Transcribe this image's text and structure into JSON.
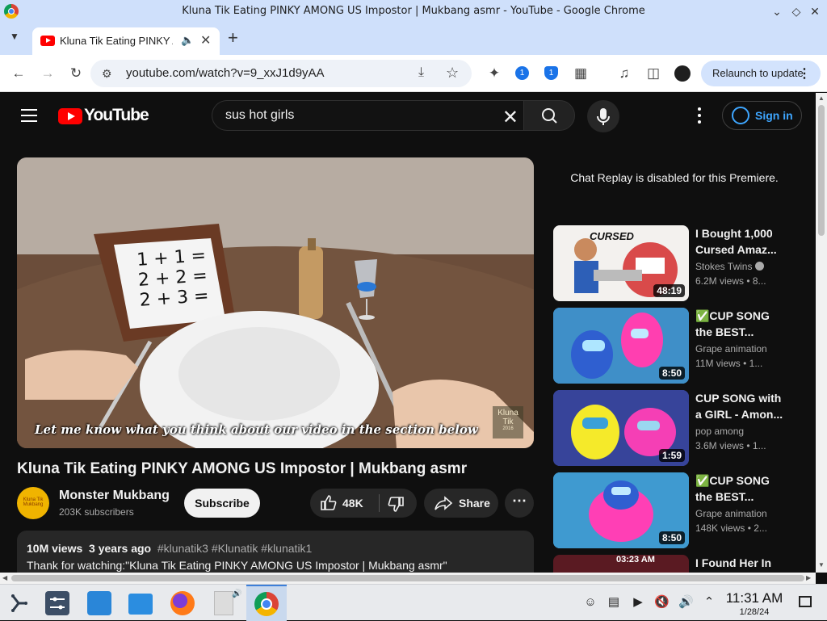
{
  "window": {
    "title": "Kluna Tik Eating PINKY AMONG US Impostor | Mukbang asmr - YouTube - Google Chrome"
  },
  "tab": {
    "label": "Kluna Tik Eating PINKY AMONG US Impostor | Mukbang asmr",
    "icon": "youtube-icon"
  },
  "toolbar": {
    "url": "youtube.com/watch?v=9_xxJ1d9yAA",
    "relaunch_label": "Relaunch to update",
    "ext_badge_1": "1",
    "ext_badge_2": "1"
  },
  "youtube": {
    "logo_text": "YouTube",
    "search_query": "sus hot girls",
    "signin_label": "Sign in"
  },
  "video": {
    "caption": "Let me know what you think about our video in the section below",
    "watermark_line1": "Kluna",
    "watermark_line2": "Tik",
    "watermark_line3": "2016",
    "whiteboard_text": "1 + 1 =\n2 + 2 =\n2 + 3 =",
    "title": "Kluna Tik Eating PINKY AMONG US Impostor | Mukbang asmr"
  },
  "channel": {
    "name": "Monster Mukbang",
    "subscribers": "203K subscribers",
    "avatar_text": "Kluna Tik Mukbang",
    "subscribe_label": "Subscribe",
    "likes": "48K",
    "share_label": "Share"
  },
  "description": {
    "views": "10M views",
    "age": "3 years ago",
    "tags": "#klunatik3 #Klunatik #klunatik1",
    "text": "Thank for watching:\"Kluna Tik Eating PINKY AMONG US Impostor | Mukbang asmr\""
  },
  "chat_note": "Chat Replay is disabled for this Premiere.",
  "recommendations": [
    {
      "title": "I Bought 1,000 Cursed Amaz...",
      "channel": "Stokes Twins",
      "stats": "6.2M views • 8...",
      "duration": "48:19",
      "thumb_text": "CURSED",
      "verified": true
    },
    {
      "title": "✅CUP SONG the BEST...",
      "channel": "Grape animation",
      "stats": "11M views • 1...",
      "duration": "8:50"
    },
    {
      "title": "CUP SONG with a GIRL - Amon...",
      "channel": "pop among",
      "stats": "3.6M views • 1...",
      "duration": "1:59"
    },
    {
      "title": "✅CUP SONG the BEST...",
      "channel": "Grape animation",
      "stats": "148K views • 2...",
      "duration": "8:50"
    },
    {
      "title": "I Found Her In",
      "channel": "",
      "stats": "",
      "duration": "",
      "thumb_text": "03:23 AM"
    }
  ],
  "taskbar": {
    "time": "11:31 AM",
    "date": "1/28/24"
  },
  "colors": {
    "youtube_red": "#ff0000",
    "page_bg": "#0f0f0f",
    "link_blue": "#3ea6ff",
    "chrome_frame": "#cfe0fb"
  }
}
